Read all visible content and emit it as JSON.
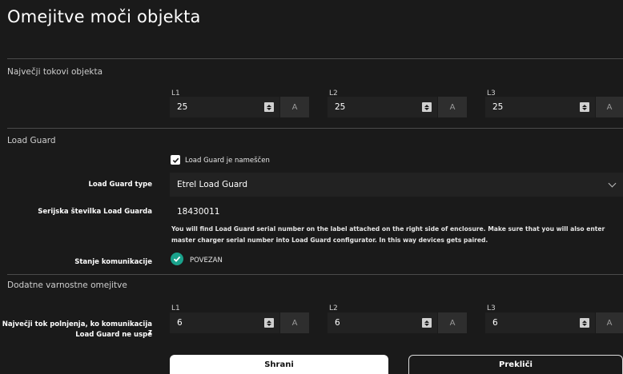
{
  "page": {
    "title": "Omejitve moči objekta"
  },
  "sections": {
    "max_currents": "Največji tokovi objekta",
    "load_guard": "Load Guard",
    "safety": "Dodatne varnostne omejitve"
  },
  "max_currents": {
    "l1_label": "L1",
    "l1_value": "25",
    "l2_label": "L2",
    "l2_value": "25",
    "l3_label": "L3",
    "l3_value": "25",
    "unit": "A"
  },
  "load_guard": {
    "installed_label": "Load Guard je nameščen",
    "installed": true,
    "type_label": "Load Guard type",
    "type_value": "Etrel Load Guard",
    "serial_label": "Serijska številka Load Guarda",
    "serial_value": "18430011",
    "help_text": "You will find Load Guard serial number on the label attached on the right side of enclosure. Make sure that you will also enter master charger serial number into Load Guard configurator. In this way devices gets paired.",
    "status_label": "Stanje komunikacije",
    "status_value": "POVEZAN",
    "status_color": "#1aa28c"
  },
  "safety": {
    "row_label_1": "Največji tok polnjenja, ko komunikacija z",
    "row_label_2": "Load Guard ne uspe",
    "l1_label": "L1",
    "l1_value": "6",
    "l2_label": "L2",
    "l2_value": "6",
    "l3_label": "L3",
    "l3_value": "6",
    "unit": "A"
  },
  "actions": {
    "save": "Shrani",
    "cancel": "Prekliči"
  }
}
